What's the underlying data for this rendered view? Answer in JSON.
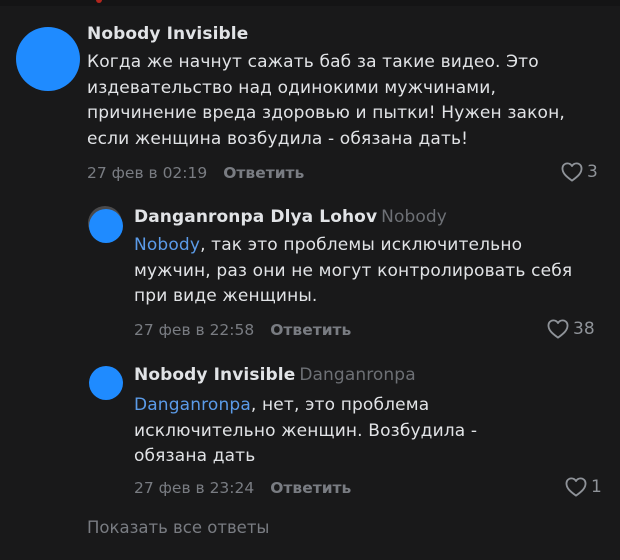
{
  "comments": [
    {
      "author": "Nobody Invisible",
      "text": "Когда же начнут сажать баб за такие видео. Это издевательство над одинокими мужчинами, причинение вреда здоровью и пытки! Нужен закон, если женщина возбудила - обязана дать!",
      "date": "27 фев в 02:19",
      "reply_label": "Ответить",
      "likes": "3"
    },
    {
      "author": "Danganronpa Dlya Lohov",
      "reply_to": "Nobody",
      "mention": "Nobody",
      "text": ", так это проблемы исключительно мужчин, раз они не могут контролировать себя при виде женщины.",
      "date": "27 фев в 22:58",
      "reply_label": "Ответить",
      "likes": "38"
    },
    {
      "author": "Nobody Invisible",
      "reply_to": "Danganronpa",
      "mention": "Danganronpa",
      "text": ", нет, это проблема исключительно женщин. Возбудила - обязана дать",
      "date": "27 фев в 23:24",
      "reply_label": "Ответить",
      "likes": "1"
    }
  ],
  "show_all_label": "Показать все ответы",
  "colors": {
    "background": "#19191a",
    "avatar": "#1f8bff",
    "mention": "#5b9be8",
    "text": "#e1e3e6",
    "muted": "#797c82"
  },
  "icons": {
    "like": "heart-outline-icon"
  }
}
